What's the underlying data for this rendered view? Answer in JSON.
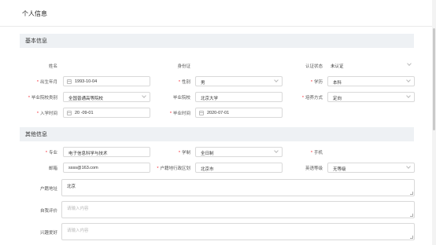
{
  "page_title": "个人信息",
  "sections": {
    "basic": "基本信息",
    "other": "其他信息"
  },
  "basic_info": {
    "name": {
      "label": "姓名",
      "value": ""
    },
    "id_card": {
      "label": "身份证",
      "value": ""
    },
    "auth_status": {
      "label": "认证状态",
      "value": "未认证"
    },
    "birth_date": {
      "label": "出生年月",
      "value": "1993-10-04"
    },
    "gender": {
      "label": "性别",
      "value": "男"
    },
    "education": {
      "label": "学历",
      "value": "本科"
    },
    "graduate_type": {
      "label": "毕业院校类别",
      "value": "全国普通高等院校"
    },
    "graduate_school": {
      "label": "毕业院校",
      "value": "北京大学"
    },
    "training_mode": {
      "label": "培养方式",
      "value": "定向"
    },
    "enroll_date": {
      "label": "入学时间",
      "value": "20 -09-01"
    },
    "graduate_date": {
      "label": "毕业时间",
      "value": "2020-07-01"
    }
  },
  "other_info": {
    "major": {
      "label": "专业",
      "value": "电子信息科学与技术"
    },
    "study_system": {
      "label": "学制",
      "value": "全日制"
    },
    "phone": {
      "label": "手机",
      "value": ""
    },
    "email": {
      "label": "邮箱",
      "value": "ssss@163.com"
    },
    "hukou_district": {
      "label": "户籍地行政区划",
      "value": "北京市"
    },
    "english_level": {
      "label": "英语等级",
      "value": "无等级"
    },
    "hukou_address": {
      "label": "户籍地址",
      "value": "北京"
    },
    "self_eval": {
      "label": "自我评价",
      "placeholder": "请输入内容"
    },
    "hobbies": {
      "label": "兴趣爱好",
      "placeholder": "请输入内容"
    }
  }
}
